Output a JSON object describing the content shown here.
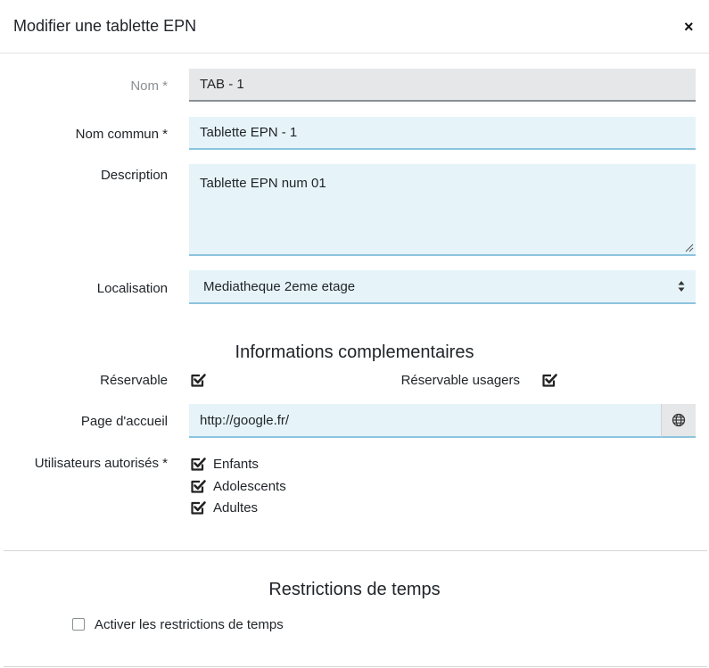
{
  "modal": {
    "title": "Modifier une tablette EPN",
    "close_label": "×"
  },
  "fields": {
    "nom": {
      "label": "Nom *",
      "value": "TAB - 1"
    },
    "nom_commun": {
      "label": "Nom commun *",
      "value": "Tablette EPN - 1"
    },
    "description": {
      "label": "Description",
      "value": "Tablette EPN num 01"
    },
    "localisation": {
      "label": "Localisation",
      "value": "Mediatheque 2eme etage"
    }
  },
  "infos": {
    "title": "Informations complementaires",
    "reservable_label": "Réservable",
    "reservable_checked": true,
    "reservable_usagers_label": "Réservable usagers",
    "reservable_usagers_checked": true,
    "page_accueil_label": "Page d'accueil",
    "page_accueil_value": "http://google.fr/",
    "page_accueil_icon": "globe-icon",
    "utilisateurs_label": "Utilisateurs autorisés *",
    "utilisateurs": [
      {
        "label": "Enfants",
        "checked": true
      },
      {
        "label": "Adolescents",
        "checked": true
      },
      {
        "label": "Adultes",
        "checked": true
      }
    ]
  },
  "restrictions": {
    "title": "Restrictions de temps",
    "activate_label": "Activer les restrictions de temps",
    "activate_checked": false
  },
  "colors": {
    "input_bg": "#e6f4fa",
    "input_border": "#8cc4de",
    "disabled_bg": "#e6e7e8"
  }
}
